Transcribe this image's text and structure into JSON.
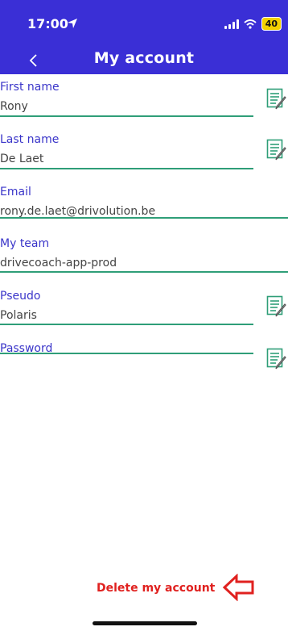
{
  "status_bar": {
    "time": "17:00",
    "battery": "40"
  },
  "nav": {
    "title": "My account"
  },
  "fields": [
    {
      "label": "First name",
      "value": "Rony",
      "editable": true
    },
    {
      "label": "Last name",
      "value": "De Laet",
      "editable": true
    },
    {
      "label": "Email",
      "value": "rony.de.laet@drivolution.be",
      "editable": false
    },
    {
      "label": "My team",
      "value": "drivecoach-app-prod",
      "editable": false
    },
    {
      "label": "Pseudo",
      "value": "Polaris",
      "editable": true
    },
    {
      "label": "Password",
      "value": "",
      "editable": true
    }
  ],
  "footer": {
    "delete_label": "Delete my account"
  },
  "colors": {
    "header": "#3a2fd6",
    "label": "#3a35c9",
    "underline": "#2f9e78",
    "danger": "#e0211f",
    "battery": "#f2d100"
  },
  "icons": {
    "location": "location-arrow-icon",
    "signal": "cellular-signal-icon",
    "wifi": "wifi-icon",
    "battery": "battery-icon",
    "back": "chevron-left-icon",
    "edit": "edit-note-icon",
    "arrow": "left-arrow-icon"
  }
}
